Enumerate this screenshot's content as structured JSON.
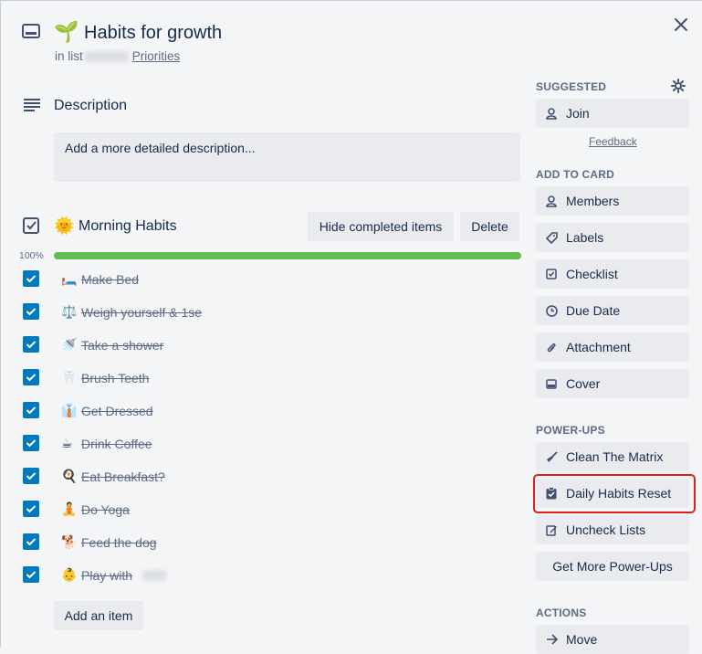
{
  "card": {
    "title_emoji": "🌱",
    "title": "Habits for growth",
    "in_list_prefix": "in list",
    "list_name": "Priorities"
  },
  "description": {
    "heading": "Description",
    "placeholder": "Add a more detailed description..."
  },
  "checklist": {
    "emoji": "🌞",
    "heading": "Morning Habits",
    "hide_completed_label": "Hide completed items",
    "delete_label": "Delete",
    "progress_text": "100%",
    "progress_percent": 100,
    "items": [
      {
        "emoji": "🛏️",
        "text": "Make Bed"
      },
      {
        "emoji": "⚖️",
        "text": "Weigh yourself & 1se"
      },
      {
        "emoji": "🚿",
        "text": "Take a shower"
      },
      {
        "emoji": "🦷",
        "text": "Brush Teeth"
      },
      {
        "emoji": "👔",
        "text": "Get Dressed"
      },
      {
        "emoji": "☕",
        "text": "Drink Coffee"
      },
      {
        "emoji": "🍳",
        "text": "Eat Breakfast?"
      },
      {
        "emoji": "🧘",
        "text": "Do Yoga"
      },
      {
        "emoji": "🐕",
        "text": "Feed the dog"
      },
      {
        "emoji": "👶",
        "text": "Play with"
      }
    ],
    "add_item_label": "Add an item"
  },
  "sidebar": {
    "suggested_heading": "SUGGESTED",
    "join_label": "Join",
    "feedback_label": "Feedback",
    "add_to_card_heading": "ADD TO CARD",
    "add_to_card": [
      {
        "icon": "person-icon",
        "label": "Members"
      },
      {
        "icon": "tag-icon",
        "label": "Labels"
      },
      {
        "icon": "checkbox-icon",
        "label": "Checklist"
      },
      {
        "icon": "clock-icon",
        "label": "Due Date"
      },
      {
        "icon": "paperclip-icon",
        "label": "Attachment"
      },
      {
        "icon": "cover-icon",
        "label": "Cover"
      }
    ],
    "power_ups_heading": "POWER-UPS",
    "power_ups": [
      {
        "icon": "broom-icon",
        "label": "Clean The Matrix"
      },
      {
        "icon": "clipboard-check-icon",
        "label": "Daily Habits Reset"
      },
      {
        "icon": "edit-icon",
        "label": "Uncheck Lists"
      }
    ],
    "get_more_label": "Get More Power-Ups",
    "actions_heading": "ACTIONS",
    "move_label": "Move"
  },
  "colors": {
    "checkbox": "#0079bf",
    "progress": "#61bd4f",
    "highlight": "#e0201f"
  }
}
